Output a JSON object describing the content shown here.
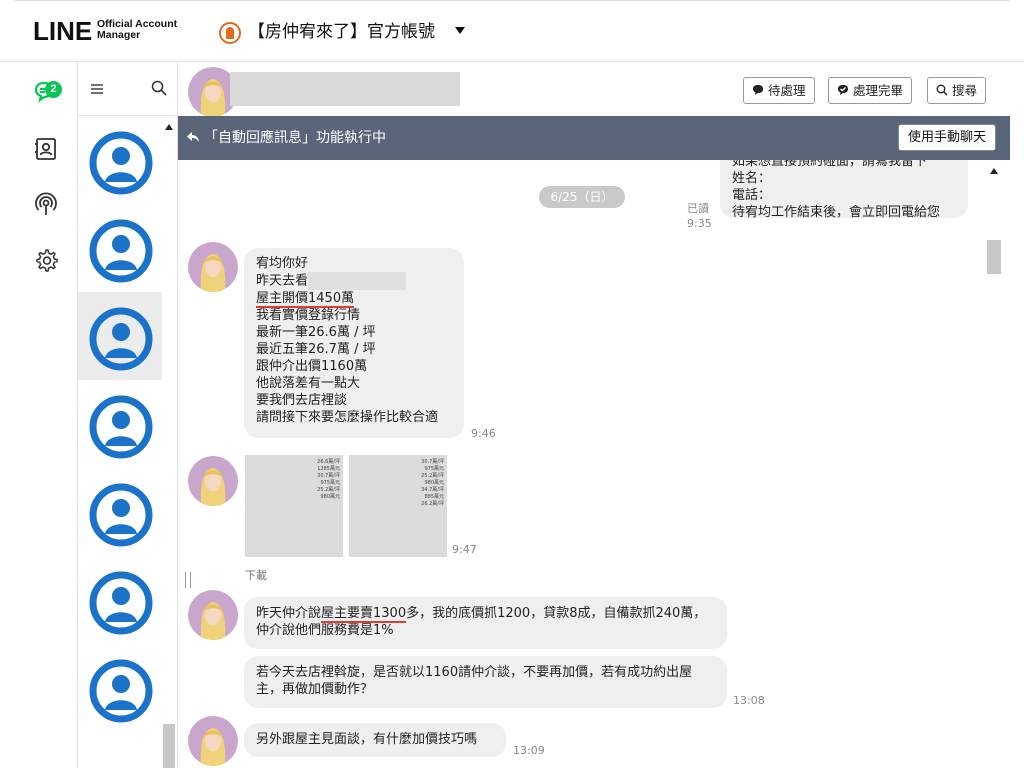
{
  "header": {
    "logo_main": "LINE",
    "logo_sub_1": "Official Account",
    "logo_sub_2": "Manager",
    "account_name": "【房仲宥來了】官方帳號"
  },
  "sidebar": {
    "unread_badge": "2",
    "icons": [
      "chat-icon",
      "contacts-icon",
      "broadcast-icon",
      "settings-icon"
    ]
  },
  "chat_header": {
    "btn_pending": "待處理",
    "btn_done": "處理完畢",
    "btn_search": "搜尋"
  },
  "auto_reply_bar": {
    "text": "「自動回應訊息」功能執行中",
    "manual_button": "使用手動聊天"
  },
  "messages": {
    "date_separator": "6/25（日）",
    "outgoing_top": {
      "line1": "如果想直接預約碰面，請寫我留下",
      "line2": "姓名：",
      "line3": "電話：",
      "line4": "待宥均工作結束後，會立即回電給您",
      "read_label": "已讀",
      "time": "9:35"
    },
    "msg1": {
      "l1": "宥均你好",
      "l2": "昨天去看",
      "l3": "屋主開價1450萬",
      "l4": "我看實價登錄行情",
      "l5": "最新一筆26.6萬 / 坪",
      "l6": "最近五筆26.7萬 / 坪",
      "l7": "跟仲介出價1160萬",
      "l8": "他說落差有一點大",
      "l9": "要我們去店裡談",
      "l10": "請問接下來要怎麼操作比較合適",
      "time": "9:46"
    },
    "images": {
      "time": "9:47",
      "download_label": "下載",
      "left_col": [
        "26.6萬/坪",
        "1285萬元",
        "30.7萬/坪",
        "975萬元",
        "25.2萬/坪",
        "980萬元"
      ],
      "right_col": [
        "30.7萬/坪",
        "975萬元",
        "25.2萬/坪",
        "980萬元",
        "34.7萬/坪",
        "885萬元",
        "26.2萬/坪"
      ]
    },
    "msg2": {
      "pre": "昨天仲介說",
      "highlight": "屋主要賣1300",
      "post": "多，我的底價抓1200，貸款8成，自備款抓240萬，仲介說他們服務費是1%"
    },
    "msg3": {
      "text": "若今天去店裡斡旋，是否就以1160請仲介談，不要再加價，若有成功約出屋主，再做加價動作？",
      "time": "13:08"
    },
    "msg4": {
      "text": "另外跟屋主見面談，有什麼加價技巧嗎",
      "time": "13:09"
    }
  }
}
